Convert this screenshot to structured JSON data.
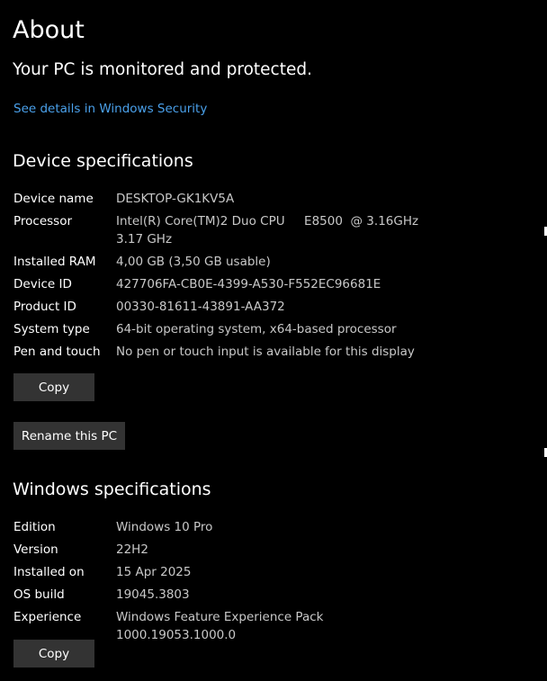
{
  "page": {
    "title": "About",
    "status": "Your PC is monitored and protected.",
    "security_link": "See details in Windows Security"
  },
  "device_specs": {
    "heading": "Device specifications",
    "rows": [
      {
        "label": "Device name",
        "value": "DESKTOP-GK1KV5A"
      },
      {
        "label": "Processor",
        "value": "Intel(R) Core(TM)2 Duo CPU     E8500  @ 3.16GHz\n3.17 GHz"
      },
      {
        "label": "Installed RAM",
        "value": "4,00 GB (3,50 GB usable)"
      },
      {
        "label": "Device ID",
        "value": "427706FA-CB0E-4399-A530-F552EC96681E"
      },
      {
        "label": "Product ID",
        "value": "00330-81611-43891-AA372"
      },
      {
        "label": "System type",
        "value": "64-bit operating system, x64-based processor"
      },
      {
        "label": "Pen and touch",
        "value": "No pen or touch input is available for this display"
      }
    ],
    "copy_label": "Copy",
    "rename_label": "Rename this PC"
  },
  "windows_specs": {
    "heading": "Windows specifications",
    "rows": [
      {
        "label": "Edition",
        "value": "Windows 10 Pro"
      },
      {
        "label": "Version",
        "value": "22H2"
      },
      {
        "label": "Installed on",
        "value": "15 Apr 2025"
      },
      {
        "label": "OS build",
        "value": "19045.3803"
      },
      {
        "label": "Experience",
        "value": "Windows Feature Experience Pack 1000.19053.1000.0"
      }
    ],
    "copy_label": "Copy"
  },
  "colors": {
    "background": "#000000",
    "text": "#ffffff",
    "secondary_text": "#c8c8c8",
    "link": "#4aa0ea",
    "button": "#333333"
  }
}
